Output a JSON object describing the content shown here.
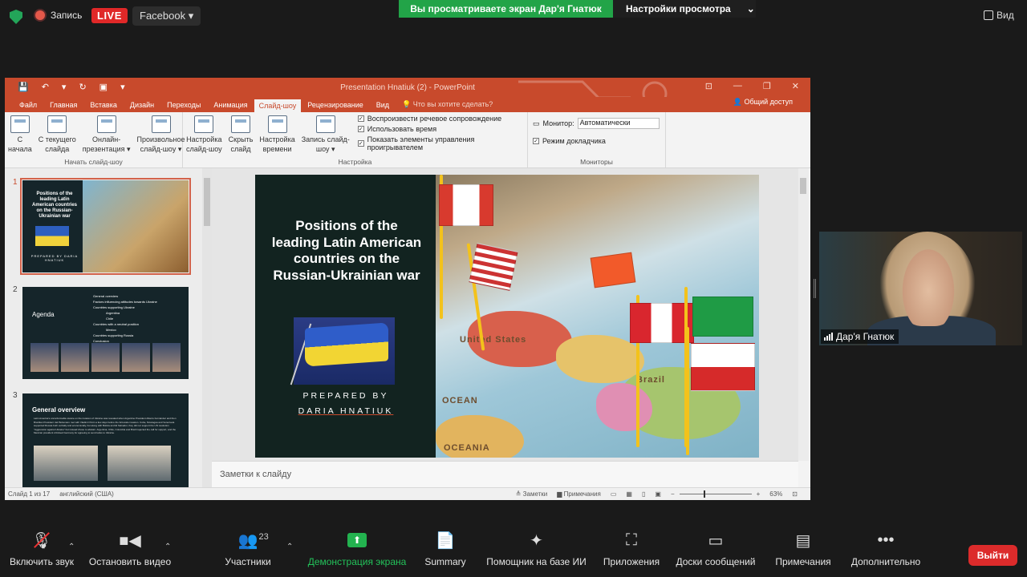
{
  "topbar": {
    "record_label": "Запись",
    "live_label": "LIVE",
    "facebook_label": "Facebook",
    "facebook_caret": "▾",
    "sharing_banner": "Вы просматриваете экран Дар'я Гнатюк",
    "view_options": "Настройки просмотра",
    "view_caret": "⌄",
    "view_label": "Вид"
  },
  "powerpoint": {
    "title": "Presentation Hnatiuk (2) - PowerPoint",
    "qat": [
      "💾",
      "↶",
      "▾",
      "↻",
      "▣",
      "▾"
    ],
    "window_controls": [
      "⊡",
      "—",
      "❐",
      "✕"
    ],
    "tabs": [
      "Файл",
      "Главная",
      "Вставка",
      "Дизайн",
      "Переходы",
      "Анимация",
      "Слайд-шоу",
      "Рецензирование",
      "Вид"
    ],
    "active_tab": "Слайд-шоу",
    "tell_me": "💡 Что вы хотите сделать?",
    "share": "👤 Общий доступ",
    "ribbon": {
      "start_group": "Начать слайд-шоу",
      "start_buttons": [
        "С\nначала",
        "С текущего\nслайда",
        "Онлайн-\nпрезентация ▾",
        "Произвольное\nслайд-шоу ▾"
      ],
      "setup_group": "Настройка",
      "setup_buttons": [
        "Настройка\nслайд-шоу",
        "Скрыть\nслайд",
        "Настройка\nвремени",
        "Запись слайд-\nшоу ▾"
      ],
      "checks": [
        "Воспроизвести речевое сопровождение",
        "Использовать время",
        "Показать элементы управления проигрывателем"
      ],
      "monitors_group": "Мониторы",
      "monitor_label": "Монитор:",
      "monitor_value": "Автоматически",
      "presenter_view": "Режим докладчика"
    },
    "thumbnails": [
      {
        "num": "1",
        "title": "Positions of the leading Latin American countries on the Russian-Ukrainian war",
        "prepared": "PREPARED BY DARIA HNATIUK"
      },
      {
        "num": "2",
        "title": "Agenda",
        "items": [
          "General overview",
          "Factors influencing attitudes towards Ukraine",
          "Countries supporting Ukraine",
          "Argentina",
          "Chile",
          "Countries with a neutral position",
          "Mexico",
          "Countries supporting Russia",
          "Conclusion"
        ]
      },
      {
        "num": "3",
        "title": "General overview",
        "text": "Latin America's unconformable stance on the invasion of Ukraine was revealed when Argentine President Alberto Fernández and then Brazilian President Jair Bolsonaro met with Vladimir Putin a few days before the full-scale invasion. Cuba, Nicaragua and Venezuela supported Russia both verbally and economically, but along with Bolivia and El Salvador, they did not support the UN resolution \"Aggression against Ukraine\" but instead chose to abstain. Argentina, Chile, Colombia and Brazil rejected the call for support, and the Mexican president criticised Germany for agreeing to send tanks to Ukraine."
      }
    ],
    "slide": {
      "title": "Positions of the leading Latin American countries on the Russian-Ukrainian war",
      "prepared_line1": "PREPARED BY",
      "prepared_line2": "DARIA HNATIUK",
      "map_labels": [
        "United States",
        "OCEAN",
        "Brazil",
        "OCEANIA"
      ]
    },
    "notes_placeholder": "Заметки к слайду",
    "status": {
      "slide_of": "Слайд 1 из 17",
      "language": "английский (США)",
      "notes": "≜ Заметки",
      "comments": "▆ Примечания",
      "zoom": "63%"
    }
  },
  "video": {
    "participant_name": "Дар'я Гнатюк"
  },
  "bottombar": {
    "unmute": "Включить звук",
    "start_video": "Остановить видео",
    "participants": "Участники",
    "participants_count": "23",
    "share_screen": "Демонстрация экрана",
    "summary": "Summary",
    "ai_companion": "Помощник на базе ИИ",
    "apps": "Приложения",
    "whiteboards": "Доски сообщений",
    "notes": "Примечания",
    "more": "Дополнительно",
    "leave": "Выйти"
  },
  "colors": {
    "ppt_accent": "#c84a2c",
    "share_green": "#22a448",
    "leave_red": "#dc2b2b",
    "live_red": "#e02828"
  }
}
